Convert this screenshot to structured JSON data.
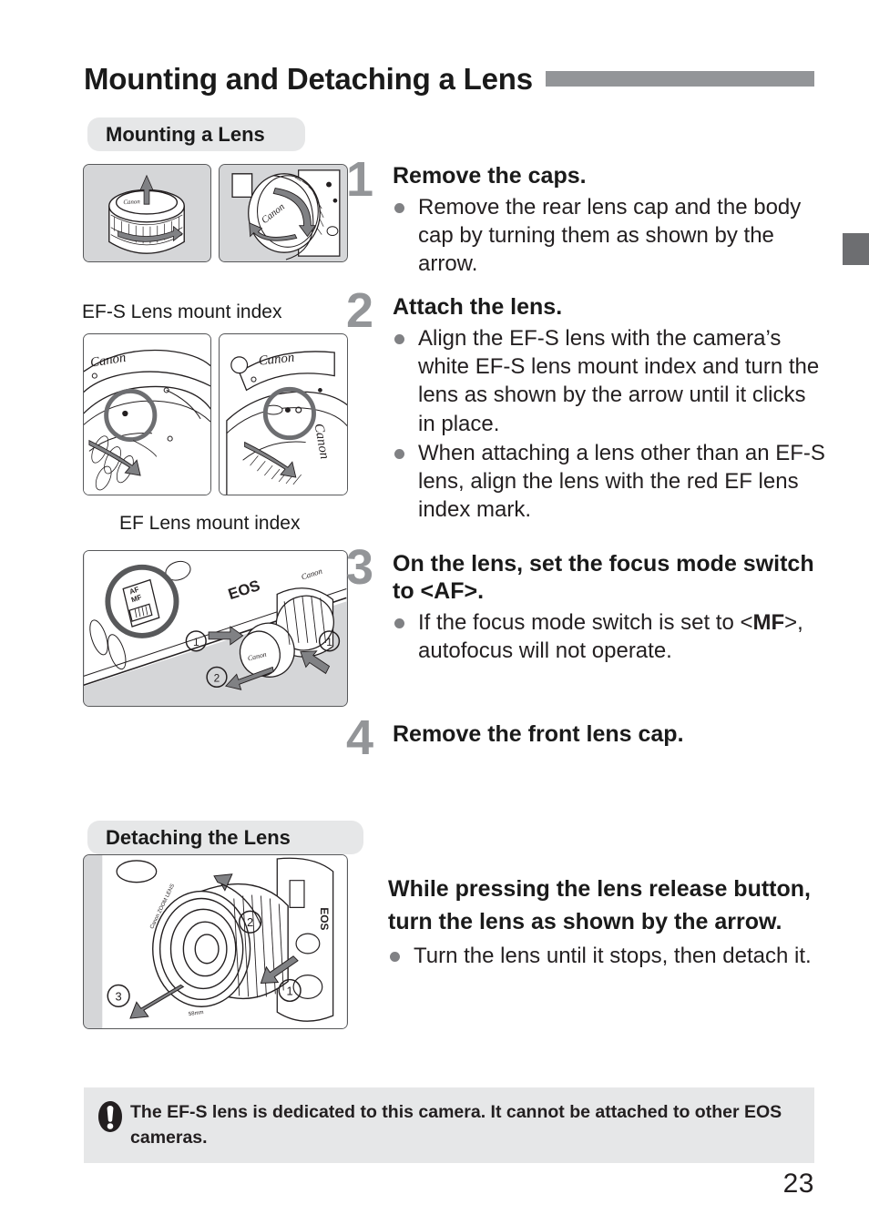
{
  "page": {
    "title": "Mounting and Detaching a Lens",
    "number": "23"
  },
  "sections": {
    "mounting": {
      "heading": "Mounting a Lens"
    },
    "detaching": {
      "heading": "Detaching the Lens"
    }
  },
  "illustration_labels": {
    "efs_mount_index": "EF-S Lens mount index",
    "ef_mount_index": "EF Lens mount index",
    "markers": {
      "one": "①",
      "two": "②",
      "three": "③"
    },
    "brand": "Canon",
    "eos": "EOS"
  },
  "steps": [
    {
      "number": "1",
      "title": "Remove the caps.",
      "bullets": [
        "Remove the rear lens cap and the body cap by turning them as shown by the arrow."
      ]
    },
    {
      "number": "2",
      "title": "Attach the lens.",
      "bullets": [
        "Align the EF-S lens with the camera’s white EF-S lens mount index and turn the lens as shown by the arrow until it clicks in place.",
        "When attaching a lens other than an EF-S lens, align the lens with the red EF lens index mark."
      ]
    },
    {
      "number": "3",
      "title_prefix": "On the lens, set the focus mode switch to <",
      "title_key": "AF",
      "title_suffix": ">.",
      "bullet_prefix": "If the focus mode switch is set to <",
      "bullet_key": "MF",
      "bullet_suffix": ">, autofocus will not operate."
    },
    {
      "number": "4",
      "title": "Remove the front lens cap.",
      "bullets": []
    }
  ],
  "detaching_block": {
    "heading": "While pressing the lens release button, turn the lens as shown by the arrow.",
    "bullets": [
      "Turn the lens until it stops, then detach it."
    ]
  },
  "caution": {
    "icon": "warning-exclamation-icon",
    "text": "The EF-S lens is dedicated to this camera. It cannot be attached to other EOS cameras."
  },
  "colors": {
    "rule_gray": "#939598",
    "pill_gray": "#e6e7e8",
    "step_number_gray": "#939598",
    "bullet_gray": "#808184",
    "edge_tab_gray": "#6d6e71",
    "illustration_bg": "#d5d6d8",
    "text_black": "#231f20"
  }
}
